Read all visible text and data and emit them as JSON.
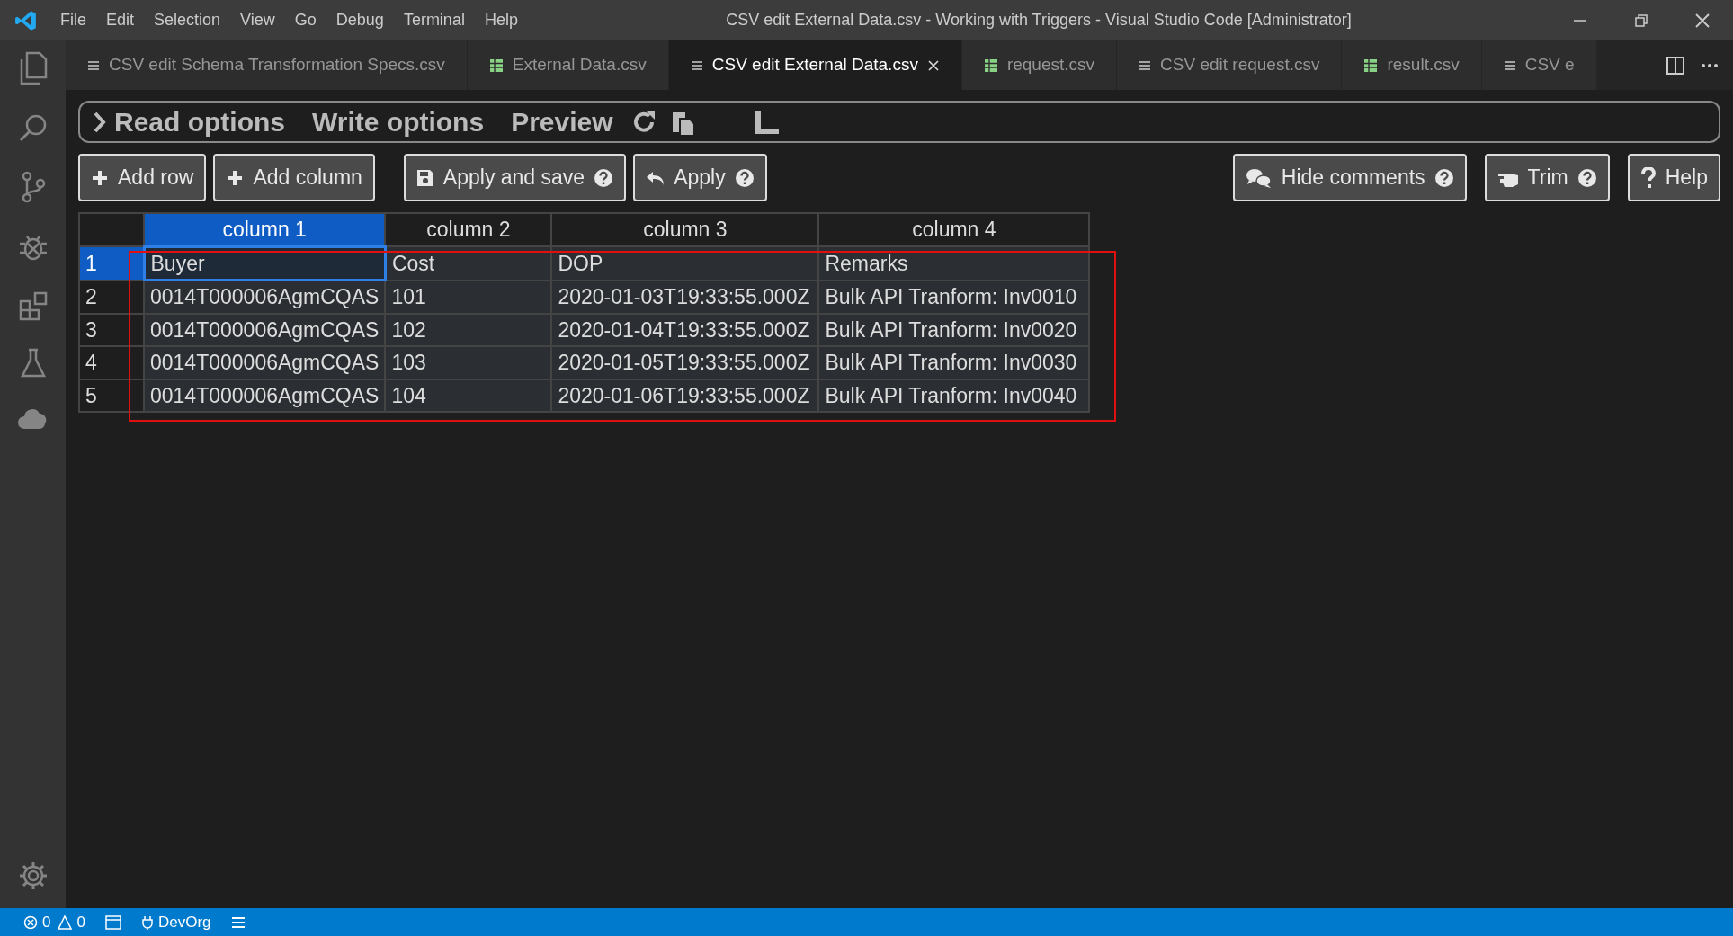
{
  "window": {
    "title": "CSV edit External Data.csv - Working with Triggers - Visual Studio Code [Administrator]"
  },
  "menu": [
    "File",
    "Edit",
    "Selection",
    "View",
    "Go",
    "Debug",
    "Terminal",
    "Help"
  ],
  "tabs": [
    {
      "label": "CSV edit Schema Transformation Specs.csv",
      "kind": "preview",
      "selected": false
    },
    {
      "label": "External Data.csv",
      "kind": "sheet",
      "selected": false
    },
    {
      "label": "CSV edit External Data.csv",
      "kind": "preview",
      "selected": true
    },
    {
      "label": "request.csv",
      "kind": "sheet",
      "selected": false
    },
    {
      "label": "CSV edit request.csv",
      "kind": "preview",
      "selected": false
    },
    {
      "label": "result.csv",
      "kind": "sheet",
      "selected": false
    },
    {
      "label": "CSV e",
      "kind": "preview",
      "selected": false
    }
  ],
  "options": [
    "Read options",
    "Write options",
    "Preview"
  ],
  "left_buttons": [
    {
      "label": "Add row",
      "kind": "plus",
      "help": false
    },
    {
      "label": "Add column",
      "kind": "plus",
      "help": false
    },
    {
      "label": "Apply and save",
      "kind": "save",
      "help": true
    },
    {
      "label": "Apply",
      "kind": "undo",
      "help": true
    }
  ],
  "right_buttons": [
    {
      "label": "Hide comments",
      "kind": "comments",
      "help": true
    },
    {
      "label": "Trim",
      "kind": "hand",
      "help": true
    },
    {
      "label": "Help",
      "kind": "question",
      "help": false
    }
  ],
  "table": {
    "columns": [
      {
        "label": "column 1",
        "selected": true
      },
      {
        "label": "column 2",
        "selected": false
      },
      {
        "label": "column 3",
        "selected": false
      },
      {
        "label": "column 4",
        "selected": false
      }
    ],
    "rows": [
      {
        "number": "1",
        "selected": true,
        "cells": [
          {
            "text": "Buyer",
            "selected": true
          },
          {
            "text": "Cost",
            "selected": false
          },
          {
            "text": "DOP",
            "selected": false
          },
          {
            "text": "Remarks",
            "selected": false
          }
        ]
      },
      {
        "number": "2",
        "selected": false,
        "cells": [
          {
            "text": "0014T000006AgmCQAS",
            "selected": false
          },
          {
            "text": "101",
            "selected": false
          },
          {
            "text": "2020-01-03T19:33:55.000Z",
            "selected": false
          },
          {
            "text": "Bulk API Tranform: Inv0010",
            "selected": false
          }
        ]
      },
      {
        "number": "3",
        "selected": false,
        "cells": [
          {
            "text": "0014T000006AgmCQAS",
            "selected": false
          },
          {
            "text": "102",
            "selected": false
          },
          {
            "text": "2020-01-04T19:33:55.000Z",
            "selected": false
          },
          {
            "text": "Bulk API Tranform: Inv0020",
            "selected": false
          }
        ]
      },
      {
        "number": "4",
        "selected": false,
        "cells": [
          {
            "text": "0014T000006AgmCQAS",
            "selected": false
          },
          {
            "text": "103",
            "selected": false
          },
          {
            "text": "2020-01-05T19:33:55.000Z",
            "selected": false
          },
          {
            "text": "Bulk API Tranform: Inv0030",
            "selected": false
          }
        ]
      },
      {
        "number": "5",
        "selected": false,
        "cells": [
          {
            "text": "0014T000006AgmCQAS",
            "selected": false
          },
          {
            "text": "104",
            "selected": false
          },
          {
            "text": "2020-01-06T19:33:55.000Z",
            "selected": false
          },
          {
            "text": "Bulk API Tranform: Inv0040",
            "selected": false
          }
        ]
      }
    ]
  },
  "status_bar": {
    "errors": "0",
    "warnings": "0",
    "org": "DevOrg"
  }
}
